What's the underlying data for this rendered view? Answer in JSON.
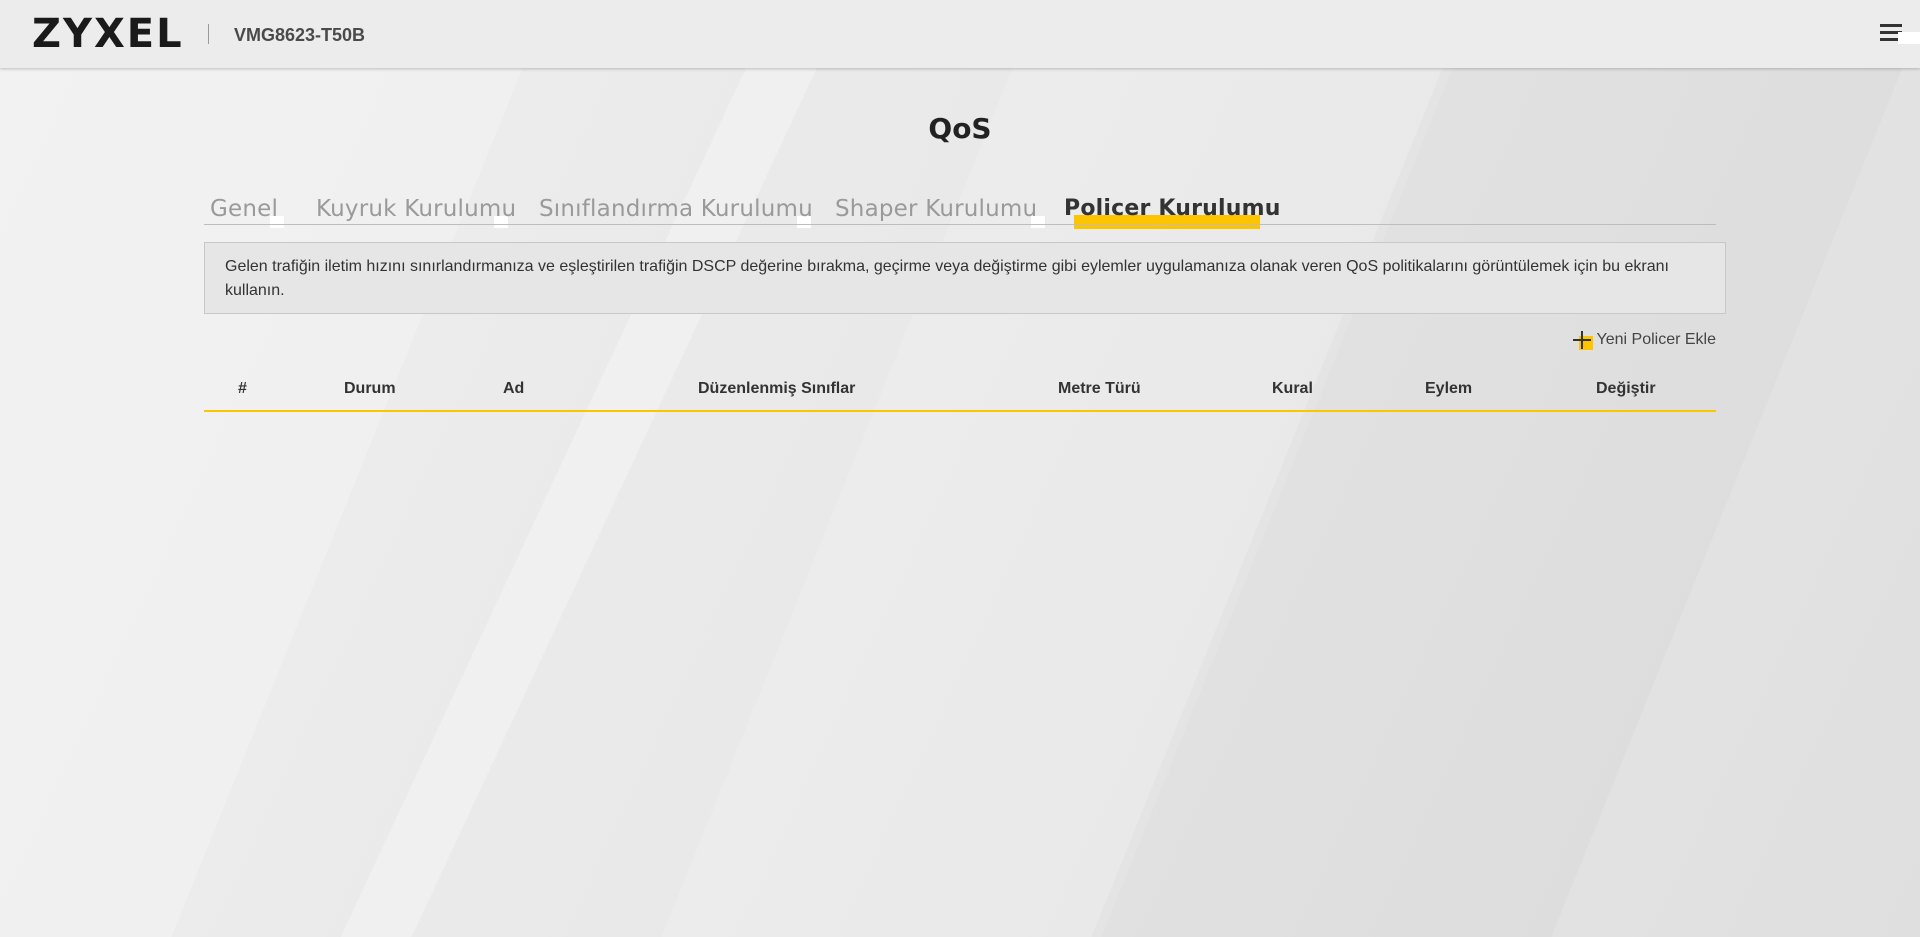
{
  "header": {
    "logo": "ZYXEL",
    "model": "VMG8623-T50B"
  },
  "page": {
    "title": "QoS"
  },
  "tabs": [
    {
      "label": "Genel",
      "active": false
    },
    {
      "label": "Kuyruk Kurulumu",
      "active": false
    },
    {
      "label": "Sınıflandırma Kurulumu",
      "active": false
    },
    {
      "label": "Shaper Kurulumu",
      "active": false
    },
    {
      "label": "Policer Kurulumu",
      "active": true
    }
  ],
  "info": {
    "text": "Gelen trafiğin iletim hızını sınırlandırmanıza ve eşleştirilen trafiğin DSCP değerine bırakma, geçirme veya değiştirme gibi eylemler uygulamanıza olanak veren QoS politikalarını görüntülemek için bu ekranı kullanın."
  },
  "actions": {
    "add_policer": "Yeni Policer Ekle"
  },
  "table": {
    "columns": [
      "#",
      "Durum",
      "Ad",
      "Düzenlenmiş Sınıflar",
      "Metre Türü",
      "Kural",
      "Eylem",
      "Değiştir"
    ],
    "rows": []
  },
  "colors": {
    "accent": "#fdc400",
    "text": "#333333",
    "inactive_tab": "#9a9a9a"
  }
}
